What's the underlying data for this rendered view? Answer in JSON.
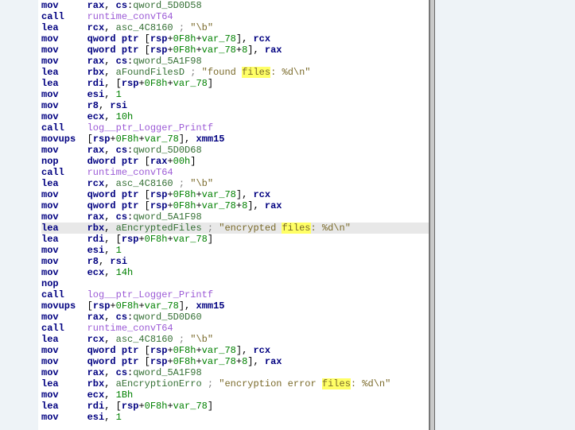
{
  "listing": [
    {
      "mn": "mov",
      "op": [
        [
          "reg",
          "rax"
        ],
        [
          "txt",
          ", "
        ],
        [
          "reg",
          "cs"
        ],
        [
          "txt",
          ":"
        ],
        [
          "sym",
          "qword_5D0D58"
        ]
      ]
    },
    {
      "mn": "call",
      "op": [
        [
          "call",
          "runtime_convT64"
        ]
      ]
    },
    {
      "mn": "lea",
      "op": [
        [
          "reg",
          "rcx"
        ],
        [
          "txt",
          ", "
        ],
        [
          "sym",
          "asc_4C8160"
        ],
        [
          "txt",
          " "
        ],
        [
          "cmt",
          "; "
        ],
        [
          "str",
          "\"\\b\""
        ]
      ]
    },
    {
      "mn": "mov",
      "op": [
        [
          "reg",
          "qword ptr"
        ],
        [
          "txt",
          " ["
        ],
        [
          "reg",
          "rsp"
        ],
        [
          "txt",
          "+"
        ],
        [
          "num",
          "0F8h"
        ],
        [
          "txt",
          "+"
        ],
        [
          "num",
          "var_78"
        ],
        [
          "txt",
          "], "
        ],
        [
          "reg",
          "rcx"
        ]
      ]
    },
    {
      "mn": "mov",
      "op": [
        [
          "reg",
          "qword ptr"
        ],
        [
          "txt",
          " ["
        ],
        [
          "reg",
          "rsp"
        ],
        [
          "txt",
          "+"
        ],
        [
          "num",
          "0F8h"
        ],
        [
          "txt",
          "+"
        ],
        [
          "num",
          "var_78"
        ],
        [
          "txt",
          "+"
        ],
        [
          "num",
          "8"
        ],
        [
          "txt",
          "], "
        ],
        [
          "reg",
          "rax"
        ]
      ]
    },
    {
      "mn": "mov",
      "op": [
        [
          "reg",
          "rax"
        ],
        [
          "txt",
          ", "
        ],
        [
          "reg",
          "cs"
        ],
        [
          "txt",
          ":"
        ],
        [
          "sym",
          "qword_5A1F98"
        ]
      ]
    },
    {
      "mn": "lea",
      "op": [
        [
          "reg",
          "rbx"
        ],
        [
          "txt",
          ", "
        ],
        [
          "sym",
          "aFoundFilesD"
        ],
        [
          "txt",
          " "
        ],
        [
          "cmt",
          "; "
        ],
        [
          "str",
          "\"found "
        ],
        [
          "mark",
          "files"
        ],
        [
          "str",
          ": %d\\n\""
        ]
      ]
    },
    {
      "mn": "lea",
      "op": [
        [
          "reg",
          "rdi"
        ],
        [
          "txt",
          ", ["
        ],
        [
          "reg",
          "rsp"
        ],
        [
          "txt",
          "+"
        ],
        [
          "num",
          "0F8h"
        ],
        [
          "txt",
          "+"
        ],
        [
          "num",
          "var_78"
        ],
        [
          "txt",
          "]"
        ]
      ]
    },
    {
      "mn": "mov",
      "op": [
        [
          "reg",
          "esi"
        ],
        [
          "txt",
          ", "
        ],
        [
          "num",
          "1"
        ]
      ]
    },
    {
      "mn": "mov",
      "op": [
        [
          "reg",
          "r8"
        ],
        [
          "txt",
          ", "
        ],
        [
          "reg",
          "rsi"
        ]
      ]
    },
    {
      "mn": "mov",
      "op": [
        [
          "reg",
          "ecx"
        ],
        [
          "txt",
          ", "
        ],
        [
          "num",
          "10h"
        ]
      ]
    },
    {
      "mn": "call",
      "op": [
        [
          "call",
          "log__ptr_Logger_Printf"
        ]
      ]
    },
    {
      "mn": "movups",
      "op": [
        [
          "txt",
          "["
        ],
        [
          "reg",
          "rsp"
        ],
        [
          "txt",
          "+"
        ],
        [
          "num",
          "0F8h"
        ],
        [
          "txt",
          "+"
        ],
        [
          "num",
          "var_78"
        ],
        [
          "txt",
          "], "
        ],
        [
          "reg",
          "xmm15"
        ]
      ]
    },
    {
      "mn": "mov",
      "op": [
        [
          "reg",
          "rax"
        ],
        [
          "txt",
          ", "
        ],
        [
          "reg",
          "cs"
        ],
        [
          "txt",
          ":"
        ],
        [
          "sym",
          "qword_5D0D68"
        ]
      ]
    },
    {
      "mn": "nop",
      "op": [
        [
          "reg",
          "dword ptr"
        ],
        [
          "txt",
          " ["
        ],
        [
          "reg",
          "rax"
        ],
        [
          "txt",
          "+"
        ],
        [
          "num",
          "00h"
        ],
        [
          "txt",
          "]"
        ]
      ]
    },
    {
      "mn": "call",
      "op": [
        [
          "call",
          "runtime_convT64"
        ]
      ]
    },
    {
      "mn": "lea",
      "op": [
        [
          "reg",
          "rcx"
        ],
        [
          "txt",
          ", "
        ],
        [
          "sym",
          "asc_4C8160"
        ],
        [
          "txt",
          " "
        ],
        [
          "cmt",
          "; "
        ],
        [
          "str",
          "\"\\b\""
        ]
      ]
    },
    {
      "mn": "mov",
      "op": [
        [
          "reg",
          "qword ptr"
        ],
        [
          "txt",
          " ["
        ],
        [
          "reg",
          "rsp"
        ],
        [
          "txt",
          "+"
        ],
        [
          "num",
          "0F8h"
        ],
        [
          "txt",
          "+"
        ],
        [
          "num",
          "var_78"
        ],
        [
          "txt",
          "], "
        ],
        [
          "reg",
          "rcx"
        ]
      ]
    },
    {
      "mn": "mov",
      "op": [
        [
          "reg",
          "qword ptr"
        ],
        [
          "txt",
          " ["
        ],
        [
          "reg",
          "rsp"
        ],
        [
          "txt",
          "+"
        ],
        [
          "num",
          "0F8h"
        ],
        [
          "txt",
          "+"
        ],
        [
          "num",
          "var_78"
        ],
        [
          "txt",
          "+"
        ],
        [
          "num",
          "8"
        ],
        [
          "txt",
          "], "
        ],
        [
          "reg",
          "rax"
        ]
      ]
    },
    {
      "mn": "mov",
      "op": [
        [
          "reg",
          "rax"
        ],
        [
          "txt",
          ", "
        ],
        [
          "reg",
          "cs"
        ],
        [
          "txt",
          ":"
        ],
        [
          "sym",
          "qword_5A1F98"
        ]
      ]
    },
    {
      "mn": "lea",
      "op": [
        [
          "reg",
          "rbx"
        ],
        [
          "txt",
          ", "
        ],
        [
          "sym",
          "aEncryptedFiles"
        ],
        [
          "txt",
          " "
        ],
        [
          "cmt",
          "; "
        ],
        [
          "str",
          "\"encrypted "
        ],
        [
          "mark",
          "files"
        ],
        [
          "str",
          ": %d\\n\""
        ]
      ],
      "hl": true
    },
    {
      "mn": "lea",
      "op": [
        [
          "reg",
          "rdi"
        ],
        [
          "txt",
          ", ["
        ],
        [
          "reg",
          "rsp"
        ],
        [
          "txt",
          "+"
        ],
        [
          "num",
          "0F8h"
        ],
        [
          "txt",
          "+"
        ],
        [
          "num",
          "var_78"
        ],
        [
          "txt",
          "]"
        ]
      ]
    },
    {
      "mn": "mov",
      "op": [
        [
          "reg",
          "esi"
        ],
        [
          "txt",
          ", "
        ],
        [
          "num",
          "1"
        ]
      ]
    },
    {
      "mn": "mov",
      "op": [
        [
          "reg",
          "r8"
        ],
        [
          "txt",
          ", "
        ],
        [
          "reg",
          "rsi"
        ]
      ]
    },
    {
      "mn": "mov",
      "op": [
        [
          "reg",
          "ecx"
        ],
        [
          "txt",
          ", "
        ],
        [
          "num",
          "14h"
        ]
      ]
    },
    {
      "mn": "nop",
      "op": []
    },
    {
      "mn": "call",
      "op": [
        [
          "call",
          "log__ptr_Logger_Printf"
        ]
      ]
    },
    {
      "mn": "movups",
      "op": [
        [
          "txt",
          "["
        ],
        [
          "reg",
          "rsp"
        ],
        [
          "txt",
          "+"
        ],
        [
          "num",
          "0F8h"
        ],
        [
          "txt",
          "+"
        ],
        [
          "num",
          "var_78"
        ],
        [
          "txt",
          "], "
        ],
        [
          "reg",
          "xmm15"
        ]
      ]
    },
    {
      "mn": "mov",
      "op": [
        [
          "reg",
          "rax"
        ],
        [
          "txt",
          ", "
        ],
        [
          "reg",
          "cs"
        ],
        [
          "txt",
          ":"
        ],
        [
          "sym",
          "qword_5D0D60"
        ]
      ]
    },
    {
      "mn": "call",
      "op": [
        [
          "call",
          "runtime_convT64"
        ]
      ]
    },
    {
      "mn": "lea",
      "op": [
        [
          "reg",
          "rcx"
        ],
        [
          "txt",
          ", "
        ],
        [
          "sym",
          "asc_4C8160"
        ],
        [
          "txt",
          " "
        ],
        [
          "cmt",
          "; "
        ],
        [
          "str",
          "\"\\b\""
        ]
      ]
    },
    {
      "mn": "mov",
      "op": [
        [
          "reg",
          "qword ptr"
        ],
        [
          "txt",
          " ["
        ],
        [
          "reg",
          "rsp"
        ],
        [
          "txt",
          "+"
        ],
        [
          "num",
          "0F8h"
        ],
        [
          "txt",
          "+"
        ],
        [
          "num",
          "var_78"
        ],
        [
          "txt",
          "], "
        ],
        [
          "reg",
          "rcx"
        ]
      ]
    },
    {
      "mn": "mov",
      "op": [
        [
          "reg",
          "qword ptr"
        ],
        [
          "txt",
          " ["
        ],
        [
          "reg",
          "rsp"
        ],
        [
          "txt",
          "+"
        ],
        [
          "num",
          "0F8h"
        ],
        [
          "txt",
          "+"
        ],
        [
          "num",
          "var_78"
        ],
        [
          "txt",
          "+"
        ],
        [
          "num",
          "8"
        ],
        [
          "txt",
          "], "
        ],
        [
          "reg",
          "rax"
        ]
      ]
    },
    {
      "mn": "mov",
      "op": [
        [
          "reg",
          "rax"
        ],
        [
          "txt",
          ", "
        ],
        [
          "reg",
          "cs"
        ],
        [
          "txt",
          ":"
        ],
        [
          "sym",
          "qword_5A1F98"
        ]
      ]
    },
    {
      "mn": "lea",
      "op": [
        [
          "reg",
          "rbx"
        ],
        [
          "txt",
          ", "
        ],
        [
          "sym",
          "aEncryptionErro"
        ],
        [
          "txt",
          " "
        ],
        [
          "cmt",
          "; "
        ],
        [
          "str",
          "\"encryption error "
        ],
        [
          "mark",
          "files"
        ],
        [
          "str",
          ": %d\\n\""
        ]
      ]
    },
    {
      "mn": "mov",
      "op": [
        [
          "reg",
          "ecx"
        ],
        [
          "txt",
          ", "
        ],
        [
          "num",
          "1Bh"
        ]
      ]
    },
    {
      "mn": "lea",
      "op": [
        [
          "reg",
          "rdi"
        ],
        [
          "txt",
          ", ["
        ],
        [
          "reg",
          "rsp"
        ],
        [
          "txt",
          "+"
        ],
        [
          "num",
          "0F8h"
        ],
        [
          "txt",
          "+"
        ],
        [
          "num",
          "var_78"
        ],
        [
          "txt",
          "]"
        ]
      ]
    },
    {
      "mn": "mov",
      "op": [
        [
          "reg",
          "esi"
        ],
        [
          "txt",
          ", "
        ],
        [
          "num",
          "1"
        ]
      ]
    }
  ]
}
